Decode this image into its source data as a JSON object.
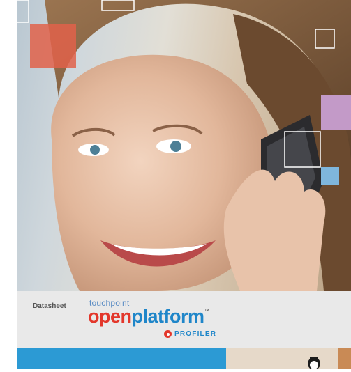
{
  "datasheet_label": "Datasheet",
  "brand": {
    "small": "touchpoint",
    "open": "open",
    "platform": "platform",
    "trademark": "™",
    "product": "PROFILER"
  },
  "colors": {
    "brand_red": "#e3372b",
    "brand_blue": "#1f86c9",
    "accent_orange": "#e0624a",
    "accent_purple": "#c39ac8",
    "accent_blue": "#7fb6dc"
  }
}
